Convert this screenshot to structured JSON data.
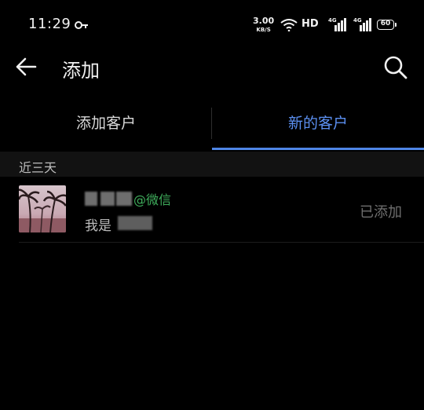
{
  "status_bar": {
    "time": "11:29",
    "net_speed_value": "3.00",
    "net_speed_unit": "KB/S",
    "hd_label": "HD",
    "sim1_label": "4G",
    "sim2_label": "4G",
    "battery_level": "60"
  },
  "header": {
    "title": "添加"
  },
  "tabs": [
    {
      "label": "添加客户",
      "active": false
    },
    {
      "label": "新的客户",
      "active": true
    }
  ],
  "section": {
    "label": "近三天"
  },
  "customers": [
    {
      "source_tag": "@微信",
      "greeting_prefix": "我是",
      "status": "已添加"
    }
  ],
  "colors": {
    "accent": "#4f86e6",
    "wechat_green": "#3fae5c",
    "background": "#000000"
  }
}
